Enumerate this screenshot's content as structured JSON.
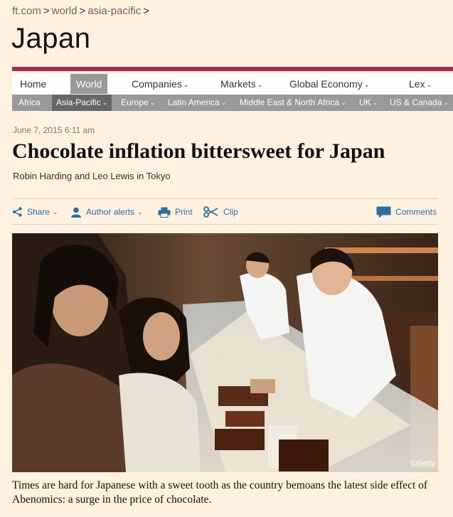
{
  "breadcrumb": {
    "items": [
      "ft.com",
      "world",
      "asia-pacific"
    ],
    "separator": ">"
  },
  "section_title": "Japan",
  "primary_nav": {
    "items": [
      {
        "label": "Home",
        "has_menu": false,
        "active": false
      },
      {
        "label": "World",
        "has_menu": false,
        "active": true
      },
      {
        "label": "Companies",
        "has_menu": true,
        "active": false
      },
      {
        "label": "Markets",
        "has_menu": true,
        "active": false
      },
      {
        "label": "Global Economy",
        "has_menu": true,
        "active": false
      },
      {
        "label": "Lex",
        "has_menu": true,
        "active": false
      }
    ]
  },
  "sub_nav": {
    "items": [
      {
        "label": "Africa",
        "has_menu": false,
        "active": false
      },
      {
        "label": "Asia-Pacific",
        "has_menu": true,
        "active": true
      },
      {
        "label": "Europe",
        "has_menu": true,
        "active": false
      },
      {
        "label": "Latin America",
        "has_menu": true,
        "active": false
      },
      {
        "label": "Middle East & North Africa",
        "has_menu": true,
        "active": false
      },
      {
        "label": "UK",
        "has_menu": true,
        "active": false
      },
      {
        "label": "US & Canada",
        "has_menu": true,
        "active": false
      }
    ]
  },
  "article": {
    "dateline": "June 7, 2015 6:11 am",
    "headline": "Chocolate inflation bittersweet for Japan",
    "byline": "Robin Harding and Leo Lewis in Tokyo",
    "caption": "Times are hard for Japanese with a sweet tooth as the country bemoans the latest side effect of Abenomics: a surge in the price of chocolate."
  },
  "toolbar": {
    "share": "Share",
    "author_alerts": "Author alerts",
    "print": "Print",
    "clip": "Clip",
    "comments": "Comments"
  },
  "photo": {
    "credit": "©Getty"
  },
  "colors": {
    "page_background": "#fff1e0",
    "accent_rule": "#9e2f50",
    "nav_active": "#999999",
    "subnav_background": "#999999",
    "subnav_active": "#666666",
    "link_blue": "#2e6e9e"
  },
  "icons": {
    "caret": "chevron-down-icon",
    "share": "share-icon",
    "author": "person-icon",
    "print": "printer-icon",
    "clip": "scissors-icon",
    "comments": "speech-bubble-icon"
  }
}
